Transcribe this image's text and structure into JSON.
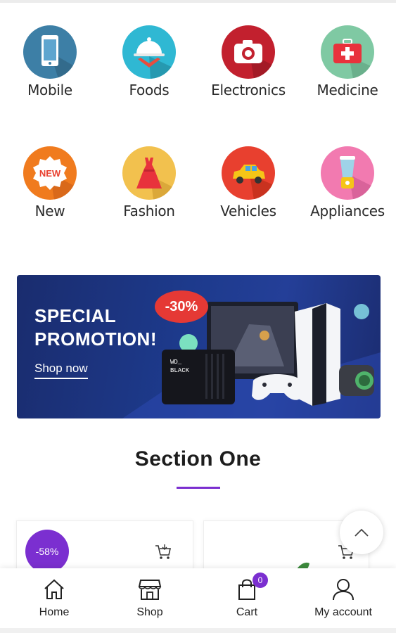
{
  "categories": [
    {
      "label": "Mobile",
      "icon": "mobile-phone-icon",
      "color": "#3d7fa6"
    },
    {
      "label": "Foods",
      "icon": "food-cloche-icon",
      "color": "#2fb8d3"
    },
    {
      "label": "Electronics",
      "icon": "camera-icon",
      "color": "#c2202e"
    },
    {
      "label": "Medicine",
      "icon": "first-aid-kit-icon",
      "color": "#7fc9a3"
    },
    {
      "label": "New",
      "icon": "new-badge-icon",
      "color": "#f07b1e"
    },
    {
      "label": "Fashion",
      "icon": "dress-icon",
      "color": "#f2c14e"
    },
    {
      "label": "Vehicles",
      "icon": "car-icon",
      "color": "#e8402f"
    },
    {
      "label": "Appliances",
      "icon": "blender-icon",
      "color": "#f27ab0"
    }
  ],
  "banner": {
    "title_line1": "SPECIAL",
    "title_line2": "PROMOTION!",
    "cta": "Shop now",
    "discount": "-30%",
    "product_text_1": "WD_",
    "product_text_2": "BLACK"
  },
  "section": {
    "title": "Section One",
    "accent": "#7b2fd0"
  },
  "products": [
    {
      "discount_badge": "-58%"
    }
  ],
  "bottom_nav": {
    "home": "Home",
    "shop": "Shop",
    "cart": "Cart",
    "cart_count": "0",
    "account": "My account"
  }
}
